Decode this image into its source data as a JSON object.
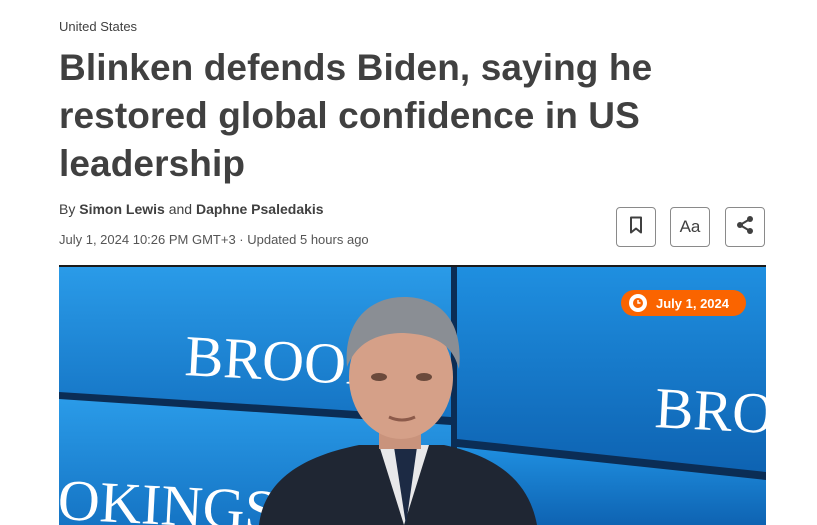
{
  "article": {
    "section": "United States",
    "headline": "Blinken defends Biden, saying he restored global confidence in US leadership",
    "byline_prefix": "By",
    "authors": [
      "Simon Lewis",
      "Daphne Psaledakis"
    ],
    "byline_joiner": "and",
    "dateline": "July 1, 2024 10:26 PM GMT+3 · Updated 5 hours ago"
  },
  "toolbar": {
    "text_size_label": "Aa"
  },
  "hero": {
    "date_badge": "July 1, 2024",
    "backdrop_text": [
      "BROOK",
      "BROO",
      "OKINGS"
    ]
  },
  "colors": {
    "accent": "#fa6400",
    "text": "#404040",
    "backdrop_blue": "#1e8fe0"
  },
  "icons": [
    "bookmark-icon",
    "share-icon",
    "clock-icon"
  ]
}
